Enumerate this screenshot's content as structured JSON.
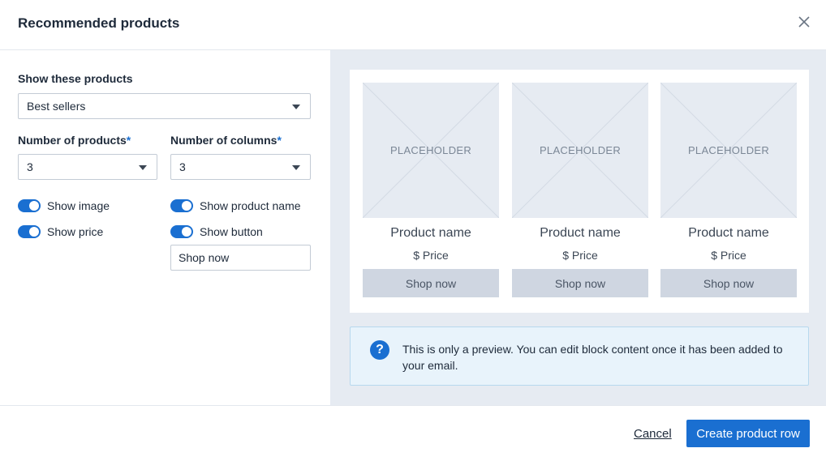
{
  "modal": {
    "title": "Recommended products",
    "close_icon": "close-icon"
  },
  "settings": {
    "show_products": {
      "label": "Show these products",
      "value": "Best sellers"
    },
    "num_products": {
      "label": "Number of products",
      "required_mark": "*",
      "value": "3"
    },
    "num_columns": {
      "label": "Number of columns",
      "required_mark": "*",
      "value": "3"
    },
    "toggles": {
      "show_image": {
        "label": "Show image",
        "on": true
      },
      "show_price": {
        "label": "Show price",
        "on": true
      },
      "show_product_name": {
        "label": "Show product name",
        "on": true
      },
      "show_button": {
        "label": "Show button",
        "on": true
      }
    },
    "button_text": {
      "value": "Shop now"
    }
  },
  "preview": {
    "products": [
      {
        "placeholder": "PLACEHOLDER",
        "name": "Product name",
        "price": "$ Price",
        "button": "Shop now"
      },
      {
        "placeholder": "PLACEHOLDER",
        "name": "Product name",
        "price": "$ Price",
        "button": "Shop now"
      },
      {
        "placeholder": "PLACEHOLDER",
        "name": "Product name",
        "price": "$ Price",
        "button": "Shop now"
      }
    ],
    "info": {
      "icon": "question-icon",
      "icon_glyph": "?",
      "text": "This is only a preview. You can edit block content once it has been added to your email."
    }
  },
  "footer": {
    "cancel_label": "Cancel",
    "create_label": "Create product row"
  },
  "colors": {
    "accent": "#1a6fd1",
    "preview_bg": "#e6ebf2",
    "info_bg": "#e8f3fb"
  }
}
